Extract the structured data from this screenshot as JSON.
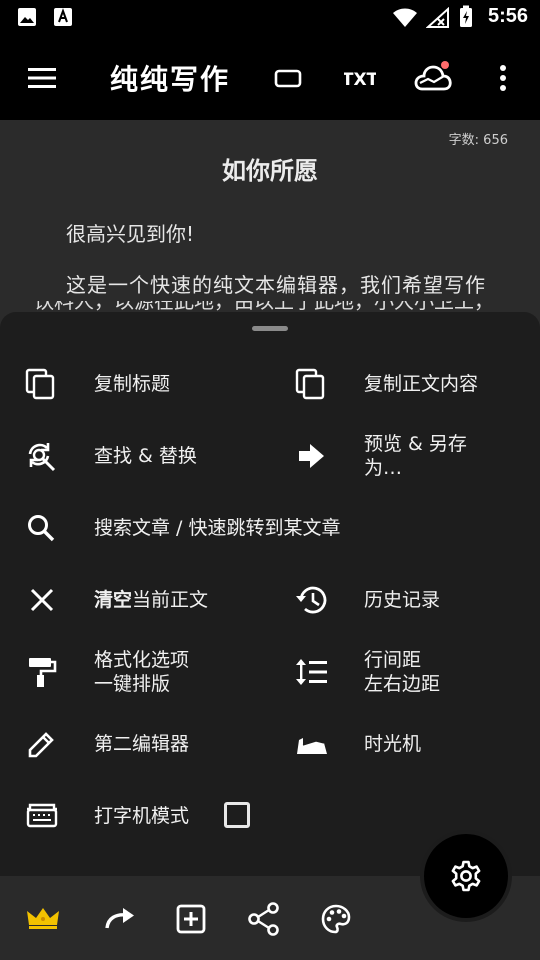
{
  "status_bar": {
    "time": "5:56"
  },
  "app_bar": {
    "title": "纯纯写作",
    "menu_icon": "menu-icon",
    "actions": [
      "fullscreen-icon",
      "txt-icon",
      "cloud-sync-icon",
      "more-vert-icon"
    ],
    "txt_label": "TXT",
    "sync_dot_color": "#ff6b6b"
  },
  "editor": {
    "word_count": "字数: 656",
    "title": "如你所愿",
    "paragraphs": [
      "很高兴见到你!",
      "这是一个快速的纯文本编辑器，我们希望写作",
      "饮料人，以源在此地，由以上于此地，小大小卫工，由立下杉"
    ]
  },
  "sheet": {
    "items": [
      {
        "label": "复制标题",
        "icon": "copy-icon"
      },
      {
        "label": "复制正文内容",
        "icon": "copy-icon"
      },
      {
        "label": "查找 & 替换",
        "icon": "find-replace-icon"
      },
      {
        "label_line1": "预览 & 另存",
        "label_line2": "为…",
        "icon": "arrow-right-icon"
      },
      {
        "label": "搜索文章 / 快速跳转到某文章",
        "icon": "search-icon"
      },
      {
        "label_bold": "清空",
        "label_rest": "当前正文",
        "icon": "close-icon"
      },
      {
        "label": "历史记录",
        "icon": "history-icon"
      },
      {
        "label_line1": "格式化选项",
        "label_line2": "一键排版",
        "icon": "format-paint-icon"
      },
      {
        "label_line1": "行间距",
        "label_line2": "左右边距",
        "icon": "line-spacing-icon"
      },
      {
        "label": "第二编辑器",
        "icon": "pencil-icon"
      },
      {
        "label": "时光机",
        "icon": "time-machine-icon"
      },
      {
        "label": "打字机模式",
        "icon": "typewriter-icon",
        "checked": false
      }
    ]
  },
  "bottom_bar": {
    "icons": [
      "crown-icon",
      "redo-icon",
      "add-box-icon",
      "share-icon",
      "palette-icon"
    ],
    "crown_color": "#f2c200",
    "fab_icon": "settings-icon"
  }
}
